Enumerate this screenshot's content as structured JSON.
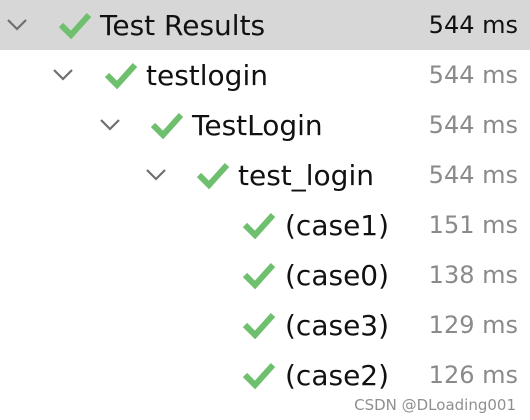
{
  "colors": {
    "check": "#6ebf6e",
    "arrow": "#6f6f6f",
    "selected_row": "#d7d7d7"
  },
  "tree": {
    "nodes": [
      {
        "label": "Test Results",
        "time": "544 ms",
        "icon": "check-icon",
        "expanded": true
      },
      {
        "label": "testlogin",
        "time": "544 ms",
        "icon": "check-icon",
        "expanded": true
      },
      {
        "label": "TestLogin",
        "time": "544 ms",
        "icon": "check-icon",
        "expanded": true
      },
      {
        "label": "test_login",
        "time": "544 ms",
        "icon": "check-icon",
        "expanded": true
      },
      {
        "label": "(case1)",
        "time": "151 ms",
        "icon": "check-icon"
      },
      {
        "label": "(case0)",
        "time": "138 ms",
        "icon": "check-icon"
      },
      {
        "label": "(case3)",
        "time": "129 ms",
        "icon": "check-icon"
      },
      {
        "label": "(case2)",
        "time": "126 ms",
        "icon": "check-icon"
      }
    ]
  },
  "watermark": "CSDN @DLoading001"
}
